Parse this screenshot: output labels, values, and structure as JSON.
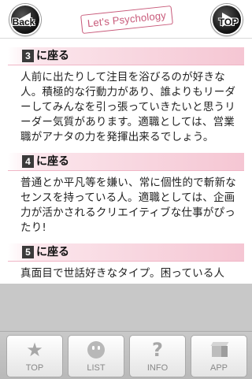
{
  "header": {
    "back_label": "Back",
    "top_label": "TOP",
    "logo_text": "Let's Psychology"
  },
  "sections": [
    {
      "number": "3",
      "heading": "に座る",
      "body": "人前に出たりして注目を浴びるのが好きな人。積極的な行動力があり、誰よりもリーダーしてみんなを引っ張っていきたいと思うリーダー気質があります。適職としては、営業職がアナタの力を発揮出来るでしょう。"
    },
    {
      "number": "4",
      "heading": "に座る",
      "body": "普通とか平凡等を嫌い、常に個性的で斬新なセンスを持っている人。適職としては、企画力が活かされるクリエイティブな仕事がぴったり!"
    },
    {
      "number": "5",
      "heading": "に座る",
      "body": "真面目で世話好きなタイプ。困っている人"
    }
  ],
  "tabbar": {
    "tabs": [
      {
        "label": "TOP",
        "icon": "star-icon"
      },
      {
        "label": "LIST",
        "icon": "smiley-icon"
      },
      {
        "label": "INFO",
        "icon": "question-icon"
      },
      {
        "label": "APP",
        "icon": "box-icon"
      }
    ]
  },
  "colors": {
    "section_head_pink": "#f5c6d3",
    "logo_pink": "#c85a7a",
    "number_box": "#3a3a3a",
    "tabbar_bg": "#c8c8c8"
  }
}
